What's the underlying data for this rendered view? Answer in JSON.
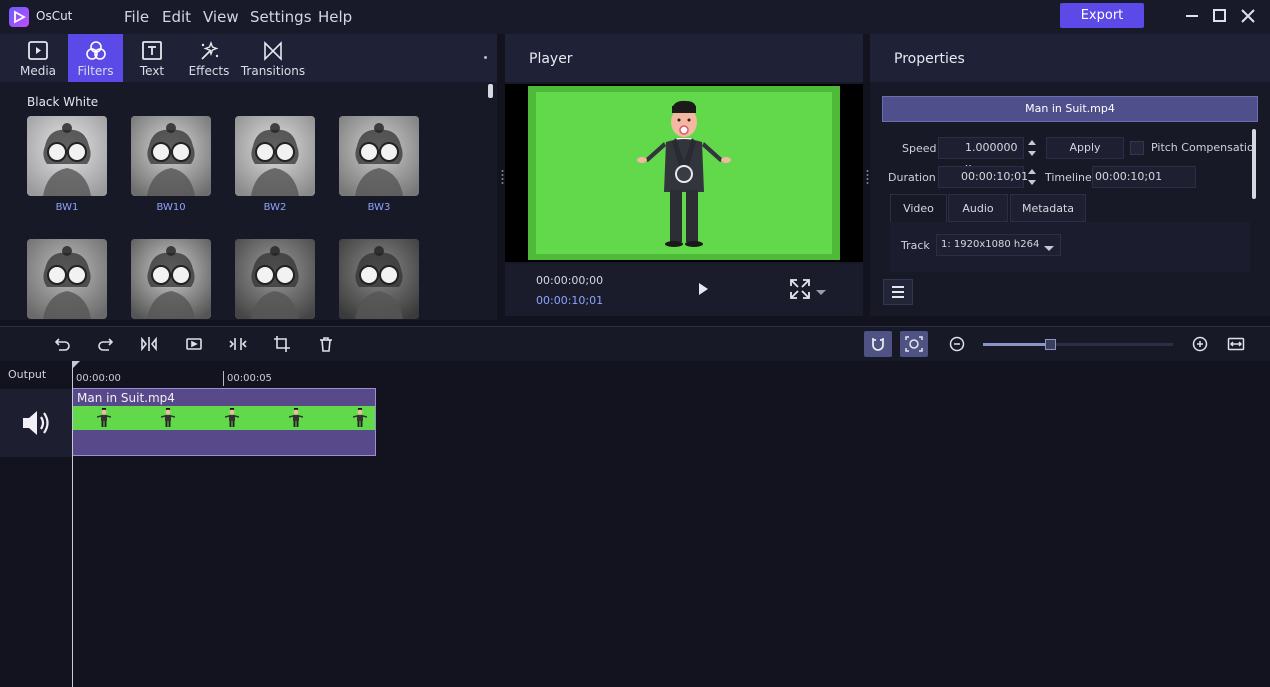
{
  "app": {
    "title": "OsCut",
    "export_label": "Export"
  },
  "menu": [
    {
      "label": "File"
    },
    {
      "label": "Edit"
    },
    {
      "label": "View"
    },
    {
      "label": "Settings"
    },
    {
      "label": "Help"
    }
  ],
  "library": {
    "tabs": [
      {
        "label": "Media",
        "icon": "play-box-icon"
      },
      {
        "label": "Filters",
        "icon": "filters-icon",
        "active": true
      },
      {
        "label": "Text",
        "icon": "text-box-icon"
      },
      {
        "label": "Effects",
        "icon": "sparkle-icon"
      },
      {
        "label": "Transitions",
        "icon": "bowtie-icon"
      }
    ],
    "category": "Black White",
    "filters": [
      {
        "label": "BW1"
      },
      {
        "label": "BW10"
      },
      {
        "label": "BW2"
      },
      {
        "label": "BW3"
      },
      {
        "label": ""
      },
      {
        "label": ""
      },
      {
        "label": ""
      },
      {
        "label": ""
      }
    ]
  },
  "player": {
    "title": "Player",
    "current_time": "00:00:00;00",
    "total_time": "00:00:10;01"
  },
  "properties": {
    "title": "Properties",
    "file_name": "Man in Suit.mp4",
    "speed_label": "Speed",
    "speed_value": "1.000000 x",
    "apply_label": "Apply",
    "pitch_label": "Pitch Compensatio",
    "duration_label": "Duration",
    "duration_value": "00:00:10;01",
    "timeline_label": "Timeline",
    "timeline_value": "00:00:10;01",
    "tabs": [
      {
        "label": "Video",
        "active": true
      },
      {
        "label": "Audio"
      },
      {
        "label": "Metadata"
      }
    ],
    "track_label": "Track",
    "track_value": "1: 1920x1080 h264"
  },
  "timeline": {
    "output_label": "Output",
    "ruler": [
      "00:00:00",
      "00:00:05"
    ],
    "clip_name": "Man in Suit.mp4",
    "zoom_level": 0.35
  },
  "colors": {
    "accent": "#5b49e8",
    "green_screen": "#62d94a",
    "clip": "#584a8a"
  }
}
